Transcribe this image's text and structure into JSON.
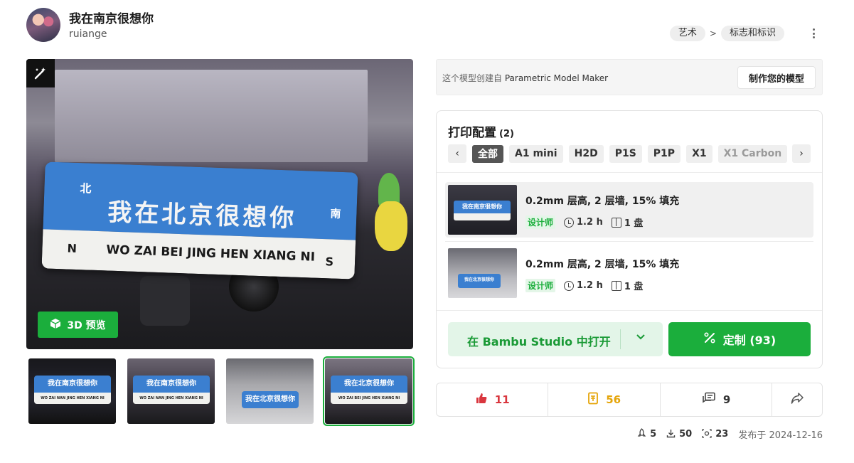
{
  "header": {
    "title": "我在南京很想你",
    "author": "ruiange",
    "breadcrumbs": [
      "艺术",
      "标志和标识"
    ],
    "breadcrumb_separator": ">"
  },
  "hero": {
    "sign_cn": "我在北京很想你",
    "sign_en": "WO ZAI BEI JING HEN XIANG NI",
    "sign_north": "北",
    "sign_south": "南",
    "sign_n": "N",
    "sign_s": "S",
    "preview_label": "3D 预览"
  },
  "thumbnails": [
    {
      "cn": "我在南京很想你",
      "en": "WO ZAI NAN JING HEN XIANG NI"
    },
    {
      "cn": "我在南京很想你",
      "en": "WO ZAI NAN JING HEN XIANG NI"
    },
    {
      "cn": "我在北京很想你",
      "en": ""
    },
    {
      "cn": "我在北京很想你",
      "en": "WO ZAI BEI JING HEN XIANG NI"
    }
  ],
  "maker": {
    "prefix": "这个模型创建自",
    "tool": "Parametric Model Maker",
    "button": "制作您的模型"
  },
  "print_profiles": {
    "title": "打印配置",
    "count": "(2)",
    "chips": [
      "全部",
      "A1 mini",
      "H2D",
      "P1S",
      "P1P",
      "X1",
      "X1 Carbon"
    ],
    "items": [
      {
        "title": "0.2mm 层高, 2 层墙, 15% 填充",
        "badge": "设计师",
        "time": "1.2 h",
        "plates": "1 盘"
      },
      {
        "title": "0.2mm 层高, 2 层墙, 15% 填充",
        "badge": "设计师",
        "time": "1.2 h",
        "plates": "1 盘"
      }
    ],
    "open_button": "在 Bambu Studio 中打开",
    "customize_button": "定制 (93)"
  },
  "actions": {
    "likes": "11",
    "favorites": "56",
    "comments": "9"
  },
  "stats": {
    "boosts": "5",
    "downloads": "50",
    "prints": "23",
    "published": "发布于 2024-12-16"
  },
  "colors": {
    "accent": "#1bae3c",
    "like": "#d9363e",
    "favorite": "#e5a50a"
  }
}
